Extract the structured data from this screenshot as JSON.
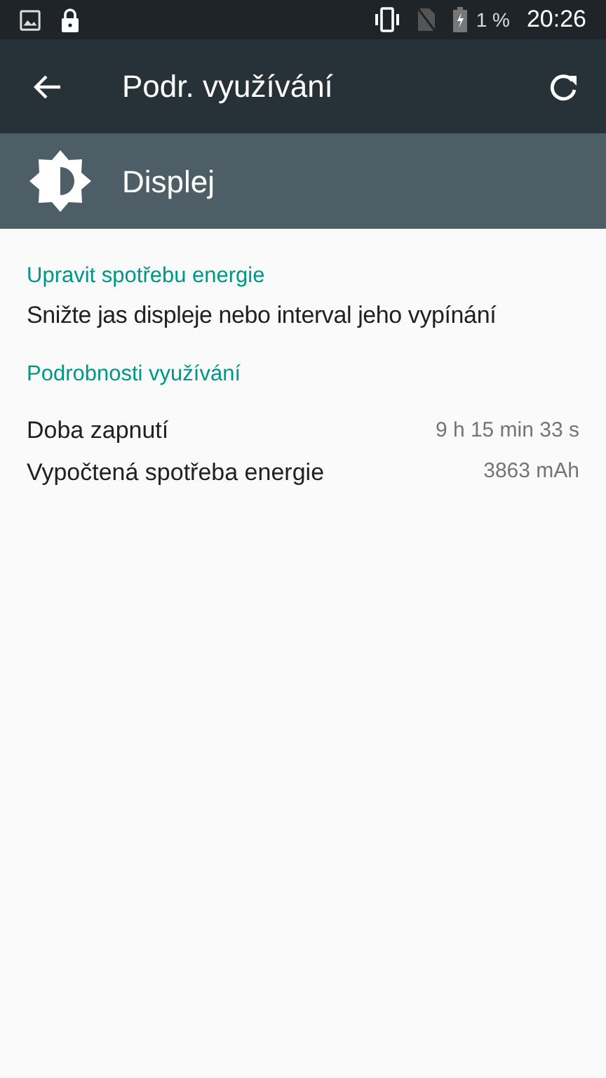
{
  "status_bar": {
    "battery": "1 %",
    "time": "20:26"
  },
  "toolbar": {
    "title": "Podr. využívání"
  },
  "header": {
    "title": "Displej"
  },
  "sections": [
    {
      "kind": "action",
      "title": "Upravit spotřebu energie",
      "text": "Snižte jas displeje nebo interval jeho vypínání"
    },
    {
      "kind": "details",
      "title": "Podrobnosti využívání",
      "rows": [
        {
          "label": "Doba zapnutí",
          "value": "9 h 15 min 33 s"
        },
        {
          "label": "Vypočtená spotřeba energie",
          "value": "3863 mAh"
        }
      ]
    }
  ]
}
